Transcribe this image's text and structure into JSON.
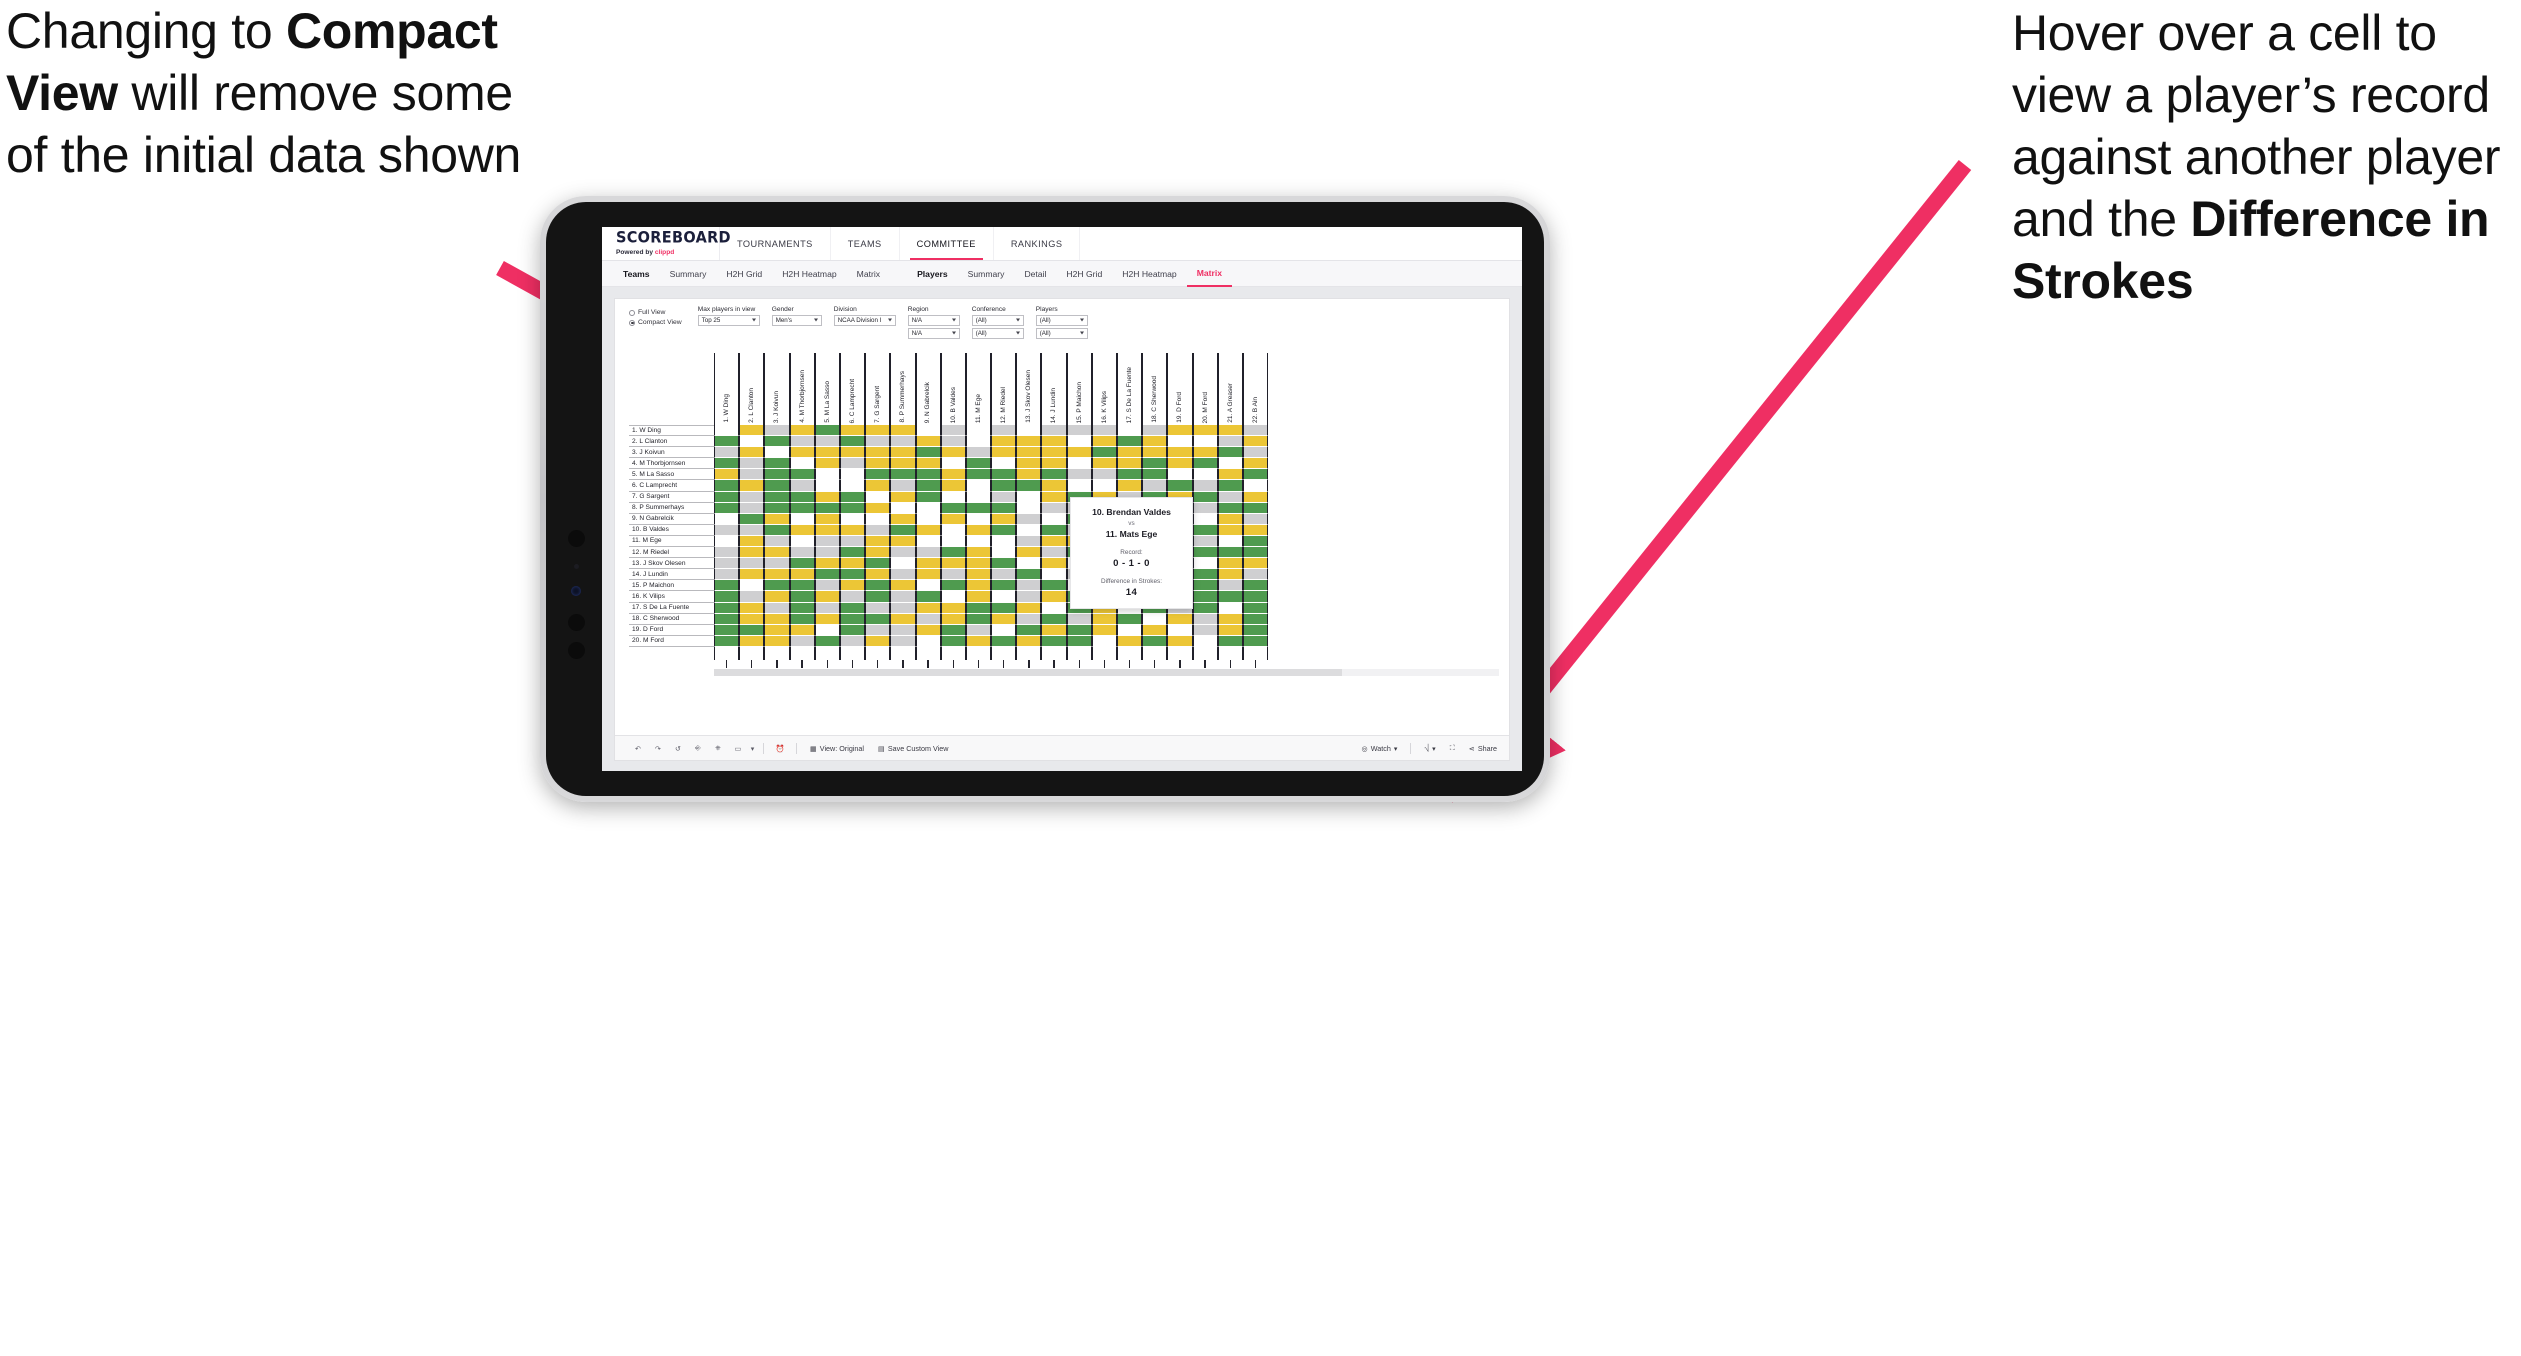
{
  "annotations": {
    "left": {
      "p1": "Changing to ",
      "b1": "Compact View",
      "p2": " will remove some of the initial data shown"
    },
    "right": {
      "p1": "Hover over a cell to view a player’s record against another player and the ",
      "b1": "Difference in Strokes"
    }
  },
  "app": {
    "logo": {
      "main": "SCOREBOARD",
      "powered": "Powered by ",
      "brand": "clippd"
    },
    "topnav": [
      {
        "label": "TOURNAMENTS",
        "active": false
      },
      {
        "label": "TEAMS",
        "active": false
      },
      {
        "label": "COMMITTEE",
        "active": true
      },
      {
        "label": "RANKINGS",
        "active": false
      }
    ],
    "subnav_left": [
      {
        "label": "Teams",
        "bold": true,
        "active": false
      },
      {
        "label": "Summary",
        "bold": false,
        "active": false
      },
      {
        "label": "H2H Grid",
        "bold": false,
        "active": false
      },
      {
        "label": "H2H Heatmap",
        "bold": false,
        "active": false
      },
      {
        "label": "Matrix",
        "bold": false,
        "active": false
      }
    ],
    "subnav_right": [
      {
        "label": "Players",
        "bold": true,
        "active": false
      },
      {
        "label": "Summary",
        "bold": false,
        "active": false
      },
      {
        "label": "Detail",
        "bold": false,
        "active": false
      },
      {
        "label": "H2H Grid",
        "bold": false,
        "active": false
      },
      {
        "label": "H2H Heatmap",
        "bold": false,
        "active": false
      },
      {
        "label": "Matrix",
        "bold": false,
        "active": true
      }
    ]
  },
  "filters": {
    "view_mode": {
      "full_label": "Full View",
      "compact_label": "Compact View",
      "selected": "Compact View"
    },
    "fields": [
      {
        "label": "Max players in view",
        "value": "Top 25",
        "value2": null
      },
      {
        "label": "Gender",
        "value": "Men's",
        "value2": null
      },
      {
        "label": "Division",
        "value": "NCAA Division I",
        "value2": null
      },
      {
        "label": "Region",
        "value": "N/A",
        "value2": "N/A"
      },
      {
        "label": "Conference",
        "value": "(All)",
        "value2": "(All)"
      },
      {
        "label": "Players",
        "value": "(All)",
        "value2": "(All)"
      }
    ]
  },
  "matrix": {
    "row_labels": [
      "1. W Ding",
      "2. L Clanton",
      "3. J Koivun",
      "4. M Thorbjornsen",
      "5. M La Sasso",
      "6. C Lamprecht",
      "7. G Sargent",
      "8. P Summerhays",
      "9. N Gabrelcik",
      "10. B Valdes",
      "11. M Ege",
      "12. M Riedel",
      "13. J Skov Olesen",
      "14. J Lundin",
      "15. P Maichon",
      "16. K Vilips",
      "17. S De La Fuente",
      "18. C Sherwood",
      "19. D Ford",
      "20. M Ford"
    ],
    "col_labels": [
      "1. W Ding",
      "2. L Clanton",
      "3. J Koivun",
      "4. M Thorbjornsen",
      "5. M La Sasso",
      "6. C Lamprecht",
      "7. G Sargent",
      "8. P Summerhays",
      "9. N Gabrelcik",
      "10. B Valdes",
      "11. M Ege",
      "12. M Riedel",
      "13. J Skov Olesen",
      "14. J Lundin",
      "15. P Maichon",
      "16. K Vilips",
      "17. S De La Fuente",
      "18. C Sherwood",
      "19. D Ford",
      "20. M Ford",
      "21. A Greaser",
      "22. B Ain"
    ],
    "legend_colors": {
      "win": "#4f9b4f",
      "loss": "#ecc636",
      "tie": "#cfcfd1",
      "none": "#ffffff"
    },
    "cells": [
      [
        "w",
        "y",
        "a",
        "y",
        "g",
        "y",
        "y",
        "y",
        "w",
        "a",
        "w",
        "a",
        "w",
        "a",
        "a",
        "a",
        "w",
        "a",
        "y",
        "y",
        "y",
        "a"
      ],
      [
        "g",
        "w",
        "g",
        "a",
        "a",
        "g",
        "a",
        "a",
        "y",
        "a",
        "w",
        "y",
        "y",
        "y",
        "w",
        "y",
        "g",
        "y",
        "w",
        "w",
        "a",
        "y"
      ],
      [
        "a",
        "y",
        "w",
        "y",
        "y",
        "y",
        "y",
        "y",
        "g",
        "y",
        "a",
        "y",
        "y",
        "y",
        "y",
        "g",
        "y",
        "y",
        "y",
        "y",
        "g",
        "a"
      ],
      [
        "g",
        "a",
        "g",
        "w",
        "y",
        "a",
        "y",
        "y",
        "y",
        "w",
        "g",
        "w",
        "y",
        "y",
        "w",
        "y",
        "y",
        "g",
        "y",
        "g",
        "w",
        "y"
      ],
      [
        "y",
        "a",
        "g",
        "g",
        "w",
        "w",
        "g",
        "g",
        "g",
        "y",
        "g",
        "g",
        "y",
        "g",
        "a",
        "a",
        "g",
        "g",
        "w",
        "w",
        "y",
        "g"
      ],
      [
        "g",
        "y",
        "g",
        "a",
        "w",
        "w",
        "y",
        "a",
        "g",
        "y",
        "w",
        "g",
        "g",
        "y",
        "w",
        "w",
        "y",
        "a",
        "g",
        "a",
        "g",
        "w"
      ],
      [
        "g",
        "a",
        "g",
        "g",
        "y",
        "g",
        "w",
        "y",
        "g",
        "w",
        "w",
        "a",
        "w",
        "y",
        "g",
        "y",
        "a",
        "g",
        "y",
        "g",
        "a",
        "y"
      ],
      [
        "g",
        "a",
        "g",
        "g",
        "g",
        "g",
        "y",
        "w",
        "w",
        "g",
        "g",
        "g",
        "w",
        "a",
        "a",
        "g",
        "g",
        "w",
        "a",
        "a",
        "g",
        "g"
      ],
      [
        "w",
        "g",
        "y",
        "w",
        "y",
        "w",
        "w",
        "y",
        "w",
        "y",
        "w",
        "y",
        "a",
        "w",
        "g",
        "g",
        "y",
        "a",
        "y",
        "w",
        "y",
        "a"
      ],
      [
        "a",
        "a",
        "g",
        "y",
        "y",
        "y",
        "a",
        "g",
        "y",
        "w",
        "y",
        "g",
        "w",
        "g",
        "a",
        "y",
        "y",
        "y",
        "g",
        "g",
        "y",
        "y"
      ],
      [
        "w",
        "y",
        "a",
        "w",
        "a",
        "a",
        "y",
        "y",
        "w",
        "w",
        "w",
        "w",
        "a",
        "y",
        "y",
        "w",
        "g",
        "y",
        "y",
        "a",
        "w",
        "g"
      ],
      [
        "a",
        "y",
        "y",
        "a",
        "a",
        "g",
        "y",
        "a",
        "a",
        "g",
        "y",
        "w",
        "y",
        "a",
        "g",
        "w",
        "y",
        "g",
        "w",
        "g",
        "g",
        "g"
      ],
      [
        "a",
        "a",
        "a",
        "g",
        "y",
        "y",
        "g",
        "w",
        "y",
        "y",
        "y",
        "g",
        "w",
        "y",
        "w",
        "y",
        "a",
        "y",
        "a",
        "w",
        "y",
        "y"
      ],
      [
        "a",
        "y",
        "y",
        "y",
        "g",
        "g",
        "y",
        "a",
        "y",
        "a",
        "y",
        "a",
        "g",
        "w",
        "a",
        "g",
        "w",
        "y",
        "a",
        "g",
        "y",
        "a"
      ],
      [
        "g",
        "w",
        "g",
        "g",
        "a",
        "y",
        "g",
        "y",
        "w",
        "g",
        "y",
        "g",
        "a",
        "g",
        "w",
        "y",
        "a",
        "g",
        "g",
        "g",
        "a",
        "g"
      ],
      [
        "g",
        "a",
        "y",
        "g",
        "y",
        "a",
        "g",
        "a",
        "g",
        "w",
        "y",
        "w",
        "a",
        "y",
        "g",
        "w",
        "y",
        "a",
        "w",
        "g",
        "g",
        "g"
      ],
      [
        "g",
        "y",
        "a",
        "g",
        "a",
        "g",
        "a",
        "a",
        "y",
        "y",
        "g",
        "g",
        "y",
        "w",
        "g",
        "y",
        "w",
        "g",
        "a",
        "g",
        "w",
        "g"
      ],
      [
        "g",
        "y",
        "y",
        "g",
        "y",
        "g",
        "g",
        "y",
        "a",
        "y",
        "g",
        "y",
        "a",
        "g",
        "a",
        "y",
        "g",
        "w",
        "y",
        "a",
        "y",
        "g"
      ],
      [
        "g",
        "g",
        "y",
        "y",
        "w",
        "g",
        "a",
        "a",
        "y",
        "g",
        "a",
        "w",
        "g",
        "y",
        "g",
        "y",
        "w",
        "y",
        "w",
        "a",
        "y",
        "g"
      ],
      [
        "g",
        "y",
        "y",
        "a",
        "g",
        "a",
        "y",
        "a",
        "w",
        "g",
        "y",
        "g",
        "y",
        "g",
        "g",
        "w",
        "y",
        "g",
        "y",
        "w",
        "g",
        "g"
      ]
    ]
  },
  "tooltip": {
    "player_a": "10. Brendan Valdes",
    "vs": "vs",
    "player_b": "11. Mats Ege",
    "record_label": "Record:",
    "record_value": "0 - 1 - 0",
    "diff_label": "Difference in Strokes:",
    "diff_value": "14"
  },
  "bottom_toolbar": {
    "icons": [
      "undo-icon",
      "redo-icon",
      "revert-icon",
      "refresh-icon",
      "pause-icon",
      "device-layout-icon",
      "caret-down-icon",
      "help-icon"
    ],
    "view_label": "View: Original",
    "save_label": "Save Custom View",
    "watch_label": "Watch",
    "share_label": "Share",
    "download_icon": "download-icon",
    "fullscreen_icon": "fullscreen-icon",
    "share_icon": "share-icon"
  },
  "colors": {
    "accent": "#ef2f63",
    "arrow": "#ef2f63",
    "green": "#4f9b4f",
    "yellow": "#ecc636",
    "gray": "#cfcfd1"
  }
}
